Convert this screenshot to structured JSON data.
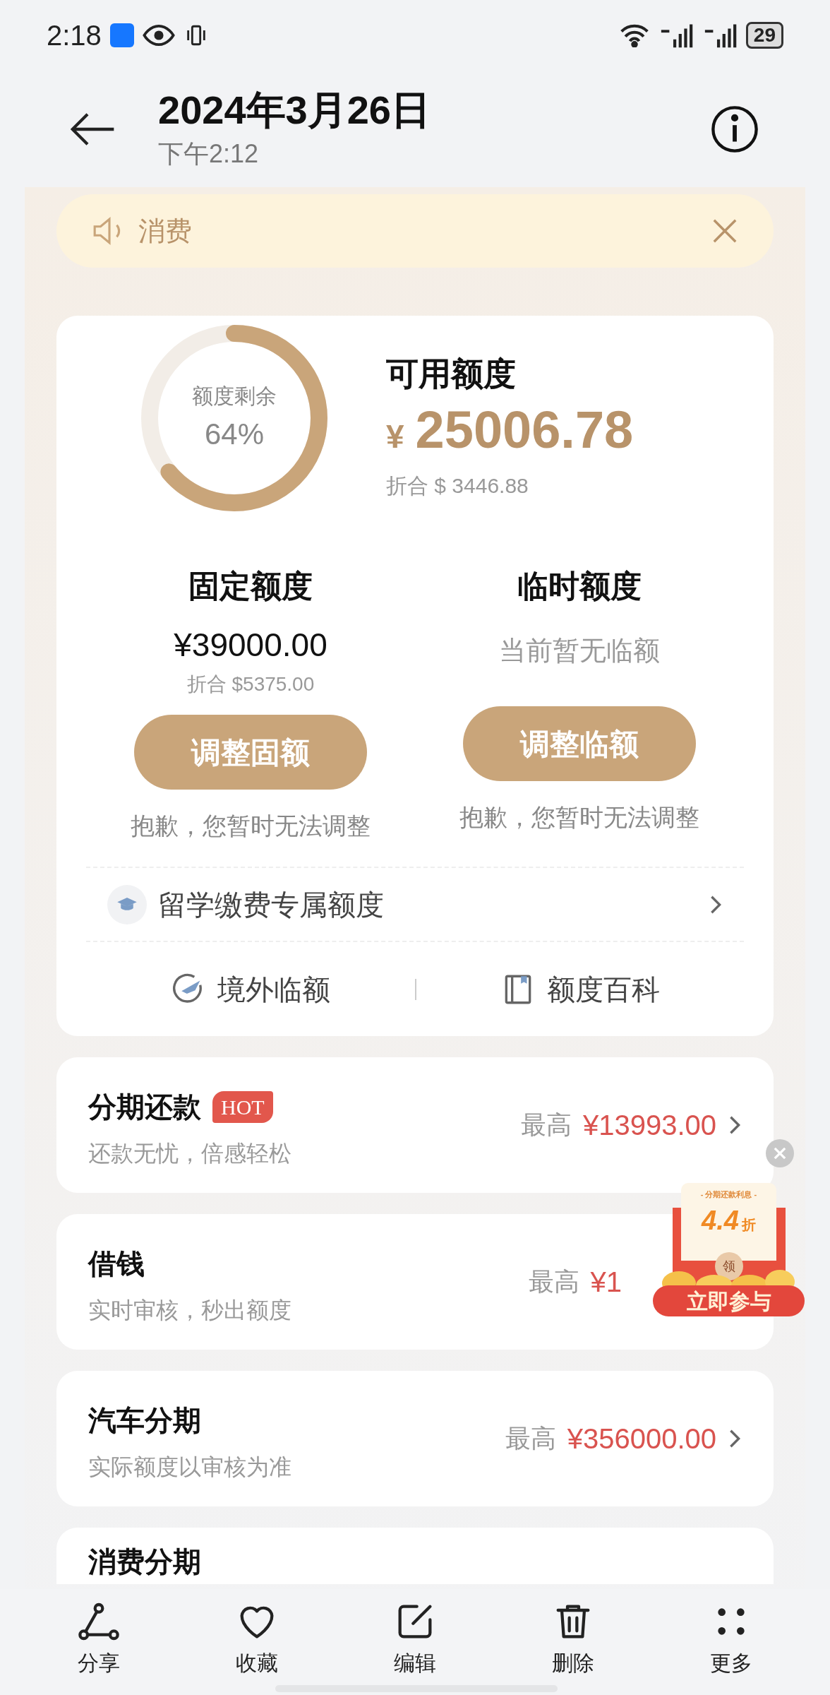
{
  "status_bar": {
    "time": "2:18",
    "battery": "29"
  },
  "header": {
    "title": "2024年3月26日",
    "subtitle": "下午2:12"
  },
  "notice": {
    "text": "消费"
  },
  "credit_card": {
    "gauge": {
      "label": "额度剩余",
      "value": "64%",
      "level": 0.64
    },
    "available": {
      "label": "可用额度",
      "symbol": "¥",
      "amount": "25006.78",
      "converted": "折合 $ 3446.88"
    },
    "fixed": {
      "label": "固定额度",
      "amount": "¥39000.00",
      "converted": "折合 $5375.00",
      "button": "调整固额",
      "note": "抱歉，您暂时无法调整"
    },
    "temporary": {
      "label": "临时额度",
      "status": "当前暂无临额",
      "button": "调整临额",
      "note": "抱歉，您暂时无法调整"
    },
    "study_link": {
      "label": "留学缴费专属额度"
    },
    "links": [
      {
        "kind": "plane",
        "label": "境外临额"
      },
      {
        "kind": "book",
        "label": "额度百科"
      }
    ]
  },
  "products": [
    {
      "title": "分期还款",
      "badge": "HOT",
      "subtitle": "还款无忧，倍感轻松",
      "prefix": "最高",
      "amount": "¥13993.00"
    },
    {
      "title": "借钱",
      "subtitle": "实时审核，秒出额度",
      "prefix": "最高",
      "amount": "¥1"
    },
    {
      "title": "汽车分期",
      "subtitle": "实际额度以审核为准",
      "prefix": "最高",
      "amount": "¥356000.00"
    },
    {
      "title": "消费分期"
    }
  ],
  "promo": {
    "caption": "- 分期还款利息 -",
    "discount": "4.4",
    "unit": "折",
    "seal": "领",
    "button": "立即参与"
  },
  "toolbar": [
    {
      "kind": "share",
      "label": "分享"
    },
    {
      "kind": "favorite",
      "label": "收藏"
    },
    {
      "kind": "edit",
      "label": "编辑"
    },
    {
      "kind": "delete",
      "label": "删除"
    },
    {
      "kind": "more",
      "label": "更多"
    }
  ]
}
